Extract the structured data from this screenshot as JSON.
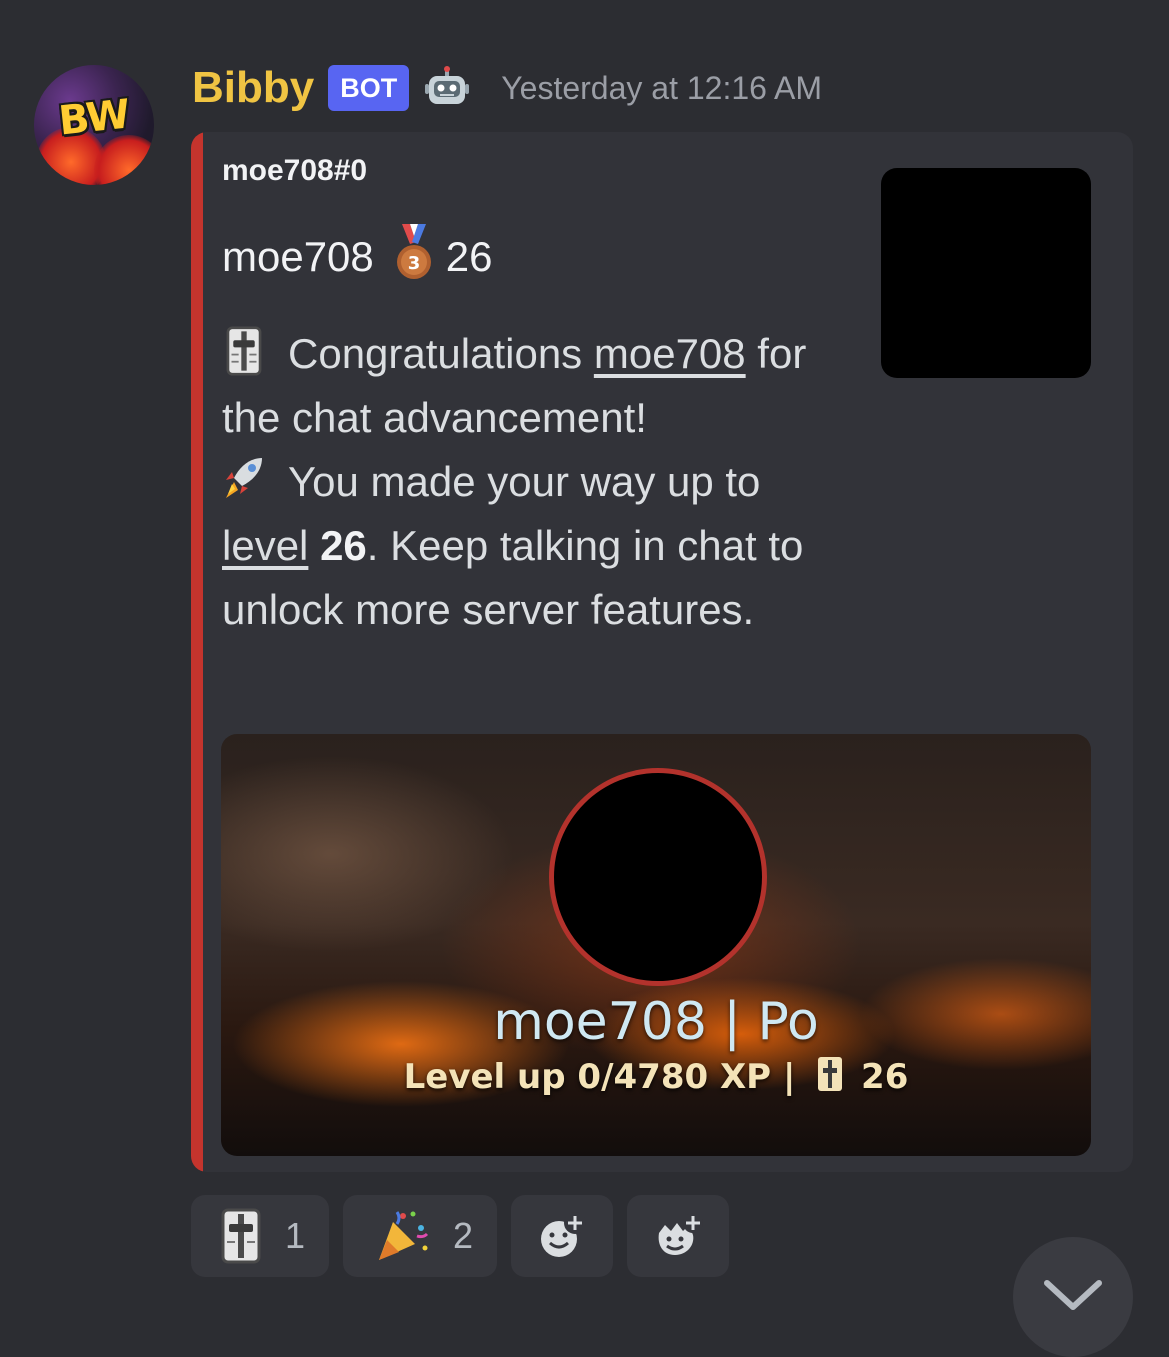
{
  "message": {
    "author": "Bibby",
    "bot_tag": "BOT",
    "timestamp": "Yesterday at 12:16 AM",
    "avatar_text": "BW"
  },
  "embed": {
    "accent_color": "#c4342d",
    "author": "moe708#0",
    "title_name": "moe708",
    "title_medal_icon": "third-place-medal",
    "title_level": "26",
    "line1_prefix": "Congratulations ",
    "line1_mention": "moe708",
    "line1_suffix": " for the chat advancement!",
    "line2_prefix": "You made your way up to ",
    "line2_link": "level",
    "line2_level": "26",
    "line2_suffix": ". Keep talking in chat to unlock more server features."
  },
  "rank_card": {
    "name_line": "moe708 | Po",
    "level_line": "Level up 0/4780 XP |",
    "level_value": "26",
    "ring_color": "#b3322c"
  },
  "reactions": [
    {
      "emoji": "level-slider-emoji",
      "count": "1"
    },
    {
      "emoji": "party-popper-emoji",
      "count": "2"
    }
  ],
  "colors": {
    "username": "#f0c443",
    "bot_tag": "#5865f2",
    "background": "#2c2d32",
    "embed_bg": "#323339"
  }
}
